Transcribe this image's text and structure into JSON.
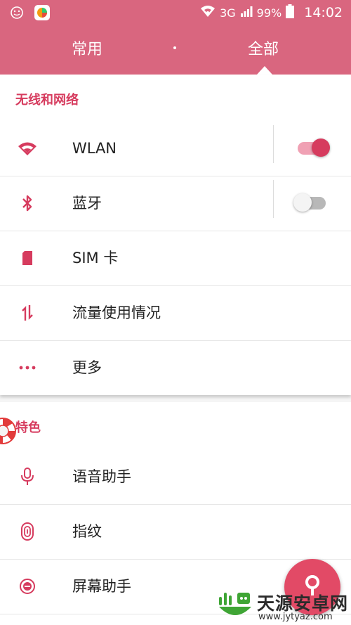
{
  "status_bar": {
    "network": "3G",
    "battery": "99%",
    "time": "14:02"
  },
  "tabs": {
    "common": "常用",
    "all": "全部",
    "selected": "all"
  },
  "sections": [
    {
      "title": "无线和网络",
      "items": [
        {
          "label": "WLAN",
          "icon": "wifi-icon",
          "switch": "on"
        },
        {
          "label": "蓝牙",
          "icon": "bluetooth-icon",
          "switch": "off"
        },
        {
          "label": "SIM 卡",
          "icon": "sim-card-icon"
        },
        {
          "label": "流量使用情况",
          "icon": "data-usage-icon"
        },
        {
          "label": "更多",
          "icon": "more-icon"
        }
      ]
    },
    {
      "title": "特色",
      "items": [
        {
          "label": "语音助手",
          "icon": "microphone-icon"
        },
        {
          "label": "指纹",
          "icon": "fingerprint-icon"
        },
        {
          "label": "屏幕助手",
          "icon": "screen-assistant-icon"
        }
      ]
    }
  ],
  "watermark": {
    "name": "天源安卓网",
    "url": "www.jytyaz.com"
  },
  "colors": {
    "accent": "#d9667f",
    "primary": "#d63b5e",
    "fab": "#e24a66"
  }
}
